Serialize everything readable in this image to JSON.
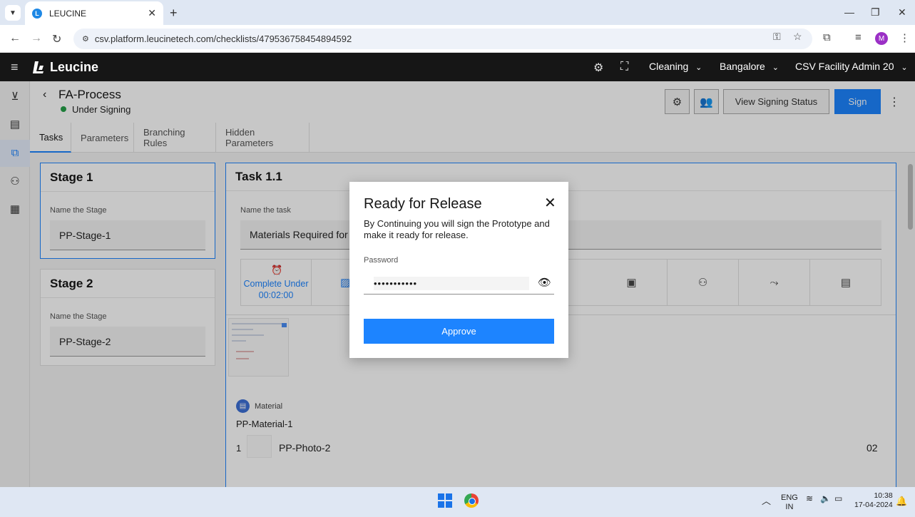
{
  "browser": {
    "tab_title": "LEUCINE",
    "url": "csv.platform.leucinetech.com/checklists/479536758454894592",
    "profile_initial": "M"
  },
  "app": {
    "brand": "Leucine",
    "header": {
      "use_case": "Cleaning",
      "facility": "Bangalore",
      "user": "CSV Facility Admin 20"
    }
  },
  "page": {
    "title": "FA-Process",
    "status": "Under Signing",
    "view_signing_status": "View Signing Status",
    "sign": "Sign",
    "tabs": [
      {
        "label": "Tasks"
      },
      {
        "label": "Parameters"
      },
      {
        "label": "Branching Rules"
      },
      {
        "label": "Hidden Parameters"
      }
    ]
  },
  "stages": [
    {
      "title": "Stage 1",
      "field_label": "Name the Stage",
      "value": "PP-Stage-1"
    },
    {
      "title": "Stage 2",
      "field_label": "Name the Stage",
      "value": "PP-Stage-2"
    }
  ],
  "task": {
    "title": "Task 1.1",
    "field_label": "Name the task",
    "value": "Materials Required for C",
    "timer_label": "Complete Under",
    "timer_value": "00:02:00",
    "material": {
      "section_label": "Material",
      "name": "PP-Material-1",
      "index": "1",
      "photo_name": "PP-Photo-2",
      "quantity": "02"
    }
  },
  "modal": {
    "title": "Ready for Release",
    "description": "By Continuing you will sign the Prototype and make it ready for release.",
    "password_label": "Password",
    "password_value": "•••••••••••",
    "approve": "Approve"
  },
  "taskbar": {
    "lang": "ENG",
    "region": "IN",
    "time": "10:38",
    "date": "17-04-2024"
  },
  "colors": {
    "accent": "#1d84ff",
    "header_bg": "#161616",
    "status_green": "#24a148"
  }
}
